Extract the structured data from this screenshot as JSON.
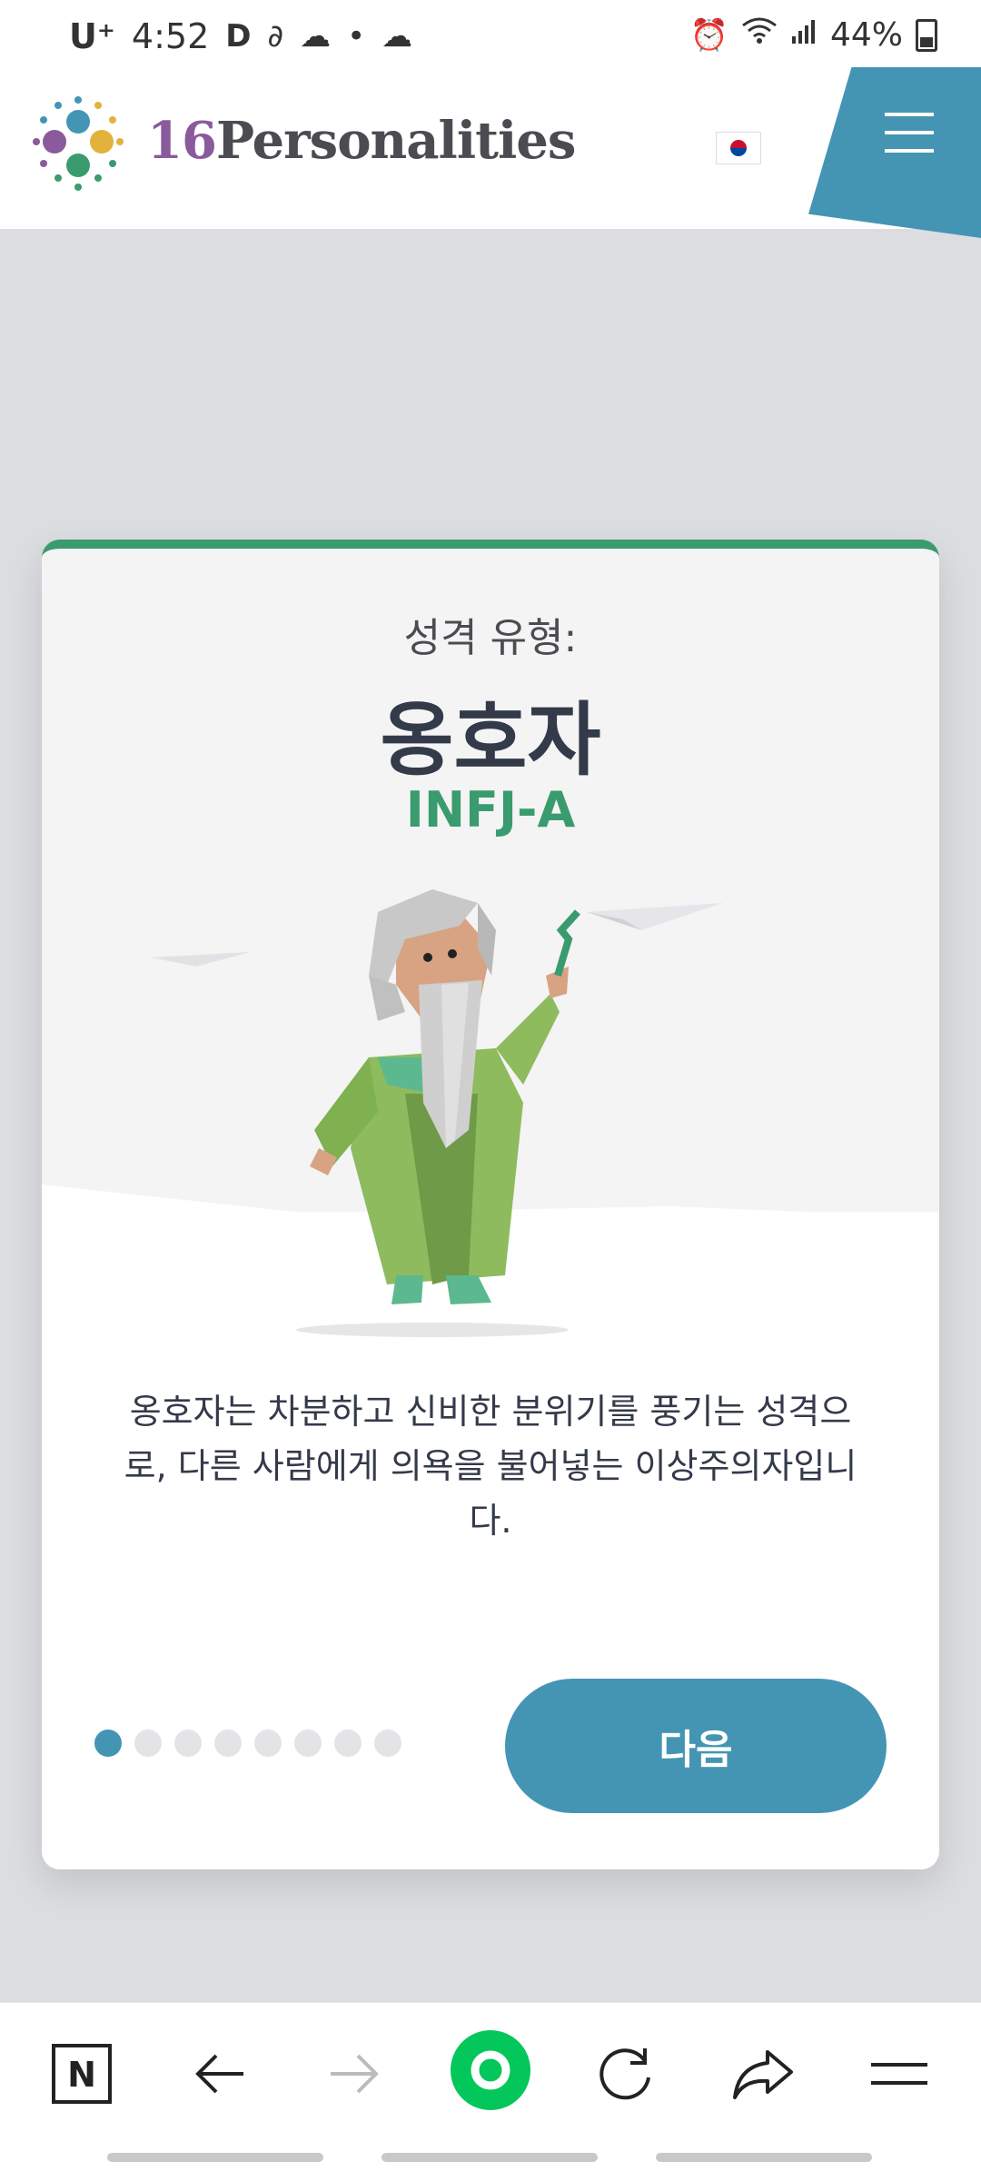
{
  "status_bar": {
    "carrier": "U⁺",
    "time": "4:52",
    "battery": "44%"
  },
  "header": {
    "brand_number": "16",
    "brand_name": "Personalities"
  },
  "card": {
    "type_label": "성격 유형:",
    "type_name": "옹호자",
    "type_code": "INFJ-A",
    "description": "옹호자는 차분하고 신비한 분위기를 풍기는 성격으로, 다른 사람에게 의욕을 불어넣는 이상주의자입니다.",
    "pagination": {
      "total": 8,
      "current": 1
    },
    "next_label": "다음"
  },
  "colors": {
    "accent": "#4495b4",
    "green": "#3a9b6e",
    "background": "#dcdde0"
  },
  "toolbar": {
    "icons": [
      "naver-icon",
      "back-icon",
      "forward-icon",
      "home-icon",
      "refresh-icon",
      "share-icon",
      "menu-icon"
    ]
  }
}
